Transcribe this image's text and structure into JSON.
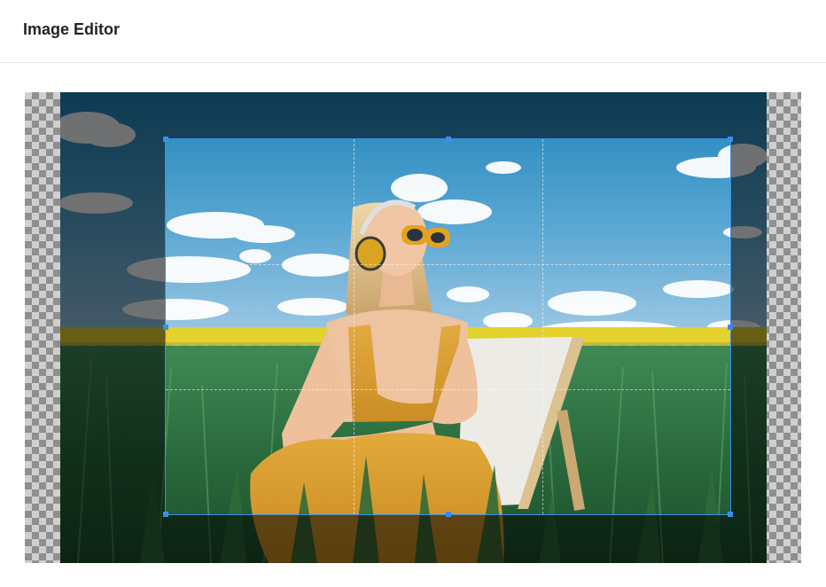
{
  "header": {
    "title": "Image Editor"
  },
  "editor": {
    "mode": "crop",
    "colors": {
      "crop_border": "#3a8eea",
      "checker_dark": "#8f8f8f",
      "checker_light": "#cfcfcf"
    }
  }
}
